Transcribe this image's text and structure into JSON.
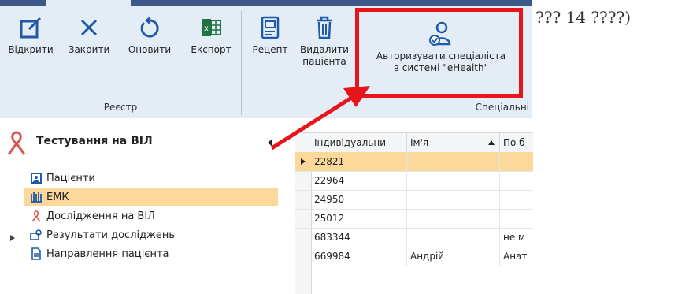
{
  "overflow_text": "??? 14 ????)",
  "ribbon": {
    "registry": {
      "label": "Реєстр",
      "buttons": [
        {
          "label": "Відкрити"
        },
        {
          "label": "Закрити"
        },
        {
          "label": "Оновити"
        },
        {
          "label": "Експорт"
        }
      ]
    },
    "special": {
      "label": "Спеціальні",
      "recipe": "Рецепт",
      "delete_line1": "Видалити",
      "delete_line2": "пацієнта",
      "authorize_line1": "Авторизувати спеціаліста",
      "authorize_line2": "в системі \"eHealth\""
    }
  },
  "sidebar": {
    "title": "Тестування на ВІЛ",
    "items": [
      {
        "label": "Пацієнти"
      },
      {
        "label": "ЕМК"
      },
      {
        "label": "Дослідження на ВІЛ"
      },
      {
        "label": "Результати досліджень"
      },
      {
        "label": "Направлення пацієнта"
      }
    ]
  },
  "grid": {
    "columns": [
      "Індивідуальни",
      "Ім'я",
      "По б"
    ],
    "rows": [
      {
        "id": "22821",
        "name": "",
        "third": ""
      },
      {
        "id": "22964",
        "name": "",
        "third": ""
      },
      {
        "id": "24950",
        "name": "",
        "third": ""
      },
      {
        "id": "25012",
        "name": "",
        "third": ""
      },
      {
        "id": "683344",
        "name": "",
        "third": "не м"
      },
      {
        "id": "669984",
        "name": "Андрій",
        "third": "Анат"
      }
    ]
  },
  "colors": {
    "highlight": "#e8141c",
    "selection": "#fcd99b",
    "accent": "#3b5a8a"
  }
}
